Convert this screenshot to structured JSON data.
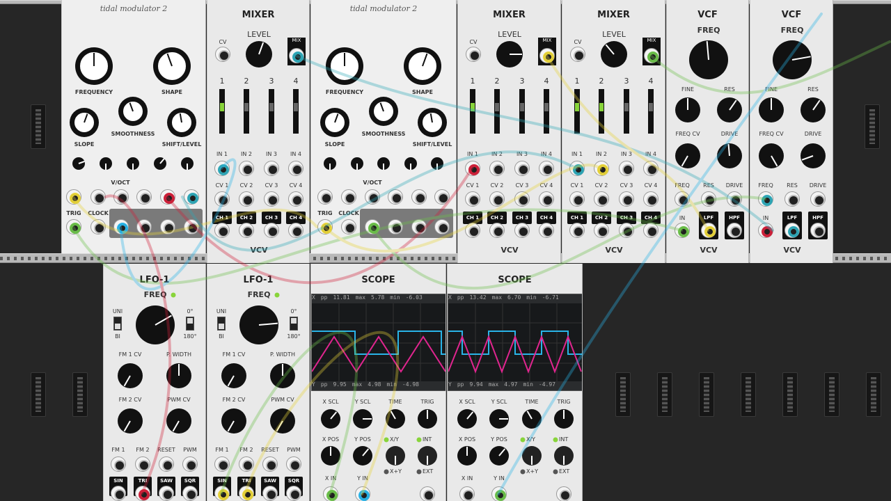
{
  "tidal": {
    "title": "tidal modulator 2",
    "labels": {
      "frequency": "FREQUENCY",
      "shape": "SHAPE",
      "slope": "SLOPE",
      "smoothness": "SMOOTHNESS",
      "shift": "SHIFT/LEVEL",
      "voct": "V/OCT",
      "trig": "TRIG",
      "clock": "CLOCK"
    }
  },
  "mixer": {
    "title": "MIXER",
    "level": "LEVEL",
    "cv": "CV",
    "mix": "MIX",
    "channels": [
      "1",
      "2",
      "3",
      "4"
    ],
    "in": [
      "IN 1",
      "IN 2",
      "IN 3",
      "IN 4"
    ],
    "cvs": [
      "CV 1",
      "CV 2",
      "CV 3",
      "CV 4"
    ],
    "ch": [
      "CH 1",
      "CH 2",
      "CH 3",
      "CH 4"
    ]
  },
  "vcf": {
    "title": "VCF",
    "freq": "FREQ",
    "fine": "FINE",
    "res": "RES",
    "freqcv": "FREQ CV",
    "drive": "DRIVE",
    "ports": [
      "FREQ",
      "RES",
      "DRIVE"
    ],
    "in": "IN",
    "lpf": "LPF",
    "hpf": "HPF"
  },
  "brand": "VCV",
  "lfo": {
    "title": "LFO-1",
    "freq": "FREQ",
    "uni": "UNI",
    "bi": "BI",
    "deg0": "0°",
    "deg180": "180°",
    "fm1cv": "FM 1 CV",
    "pwidth": "P. WIDTH",
    "fm2cv": "FM 2 CV",
    "pwmcv": "PWM CV",
    "ports": [
      "FM 1",
      "FM 2",
      "RESET",
      "PWM"
    ],
    "waves": [
      "SIN",
      "TRI",
      "SAW",
      "SQR"
    ]
  },
  "scope1": {
    "title": "SCOPE",
    "x": {
      "pp": "11.81",
      "max": "5.78",
      "min": "-6.03"
    },
    "y": {
      "pp": "9.95",
      "max": "4.98",
      "min": "-4.98"
    }
  },
  "scope2": {
    "title": "SCOPE",
    "x": {
      "pp": "13.42",
      "max": "6.70",
      "min": "-6.71"
    },
    "y": {
      "pp": "9.94",
      "max": "4.97",
      "min": "-4.97"
    }
  },
  "scope": {
    "xlabel": "X",
    "ylabel": "Y",
    "pp": "pp",
    "max": "max",
    "min": "min",
    "xscl": "X SCL",
    "yscl": "Y SCL",
    "time": "TIME",
    "trig": "TRIG",
    "xpos": "X POS",
    "ypos": "Y POS",
    "xy": "X/Y",
    "xplusy": "X+Y",
    "int": "INT",
    "ext": "EXT",
    "xin": "X IN",
    "yin": "Y IN"
  },
  "colors": {
    "cyan": "#29b4e8",
    "magenta": "#e0258f",
    "green": "#6cc04a",
    "yellow": "#e8d43a",
    "red": "#d0213a",
    "teal": "#2fa8b8"
  }
}
